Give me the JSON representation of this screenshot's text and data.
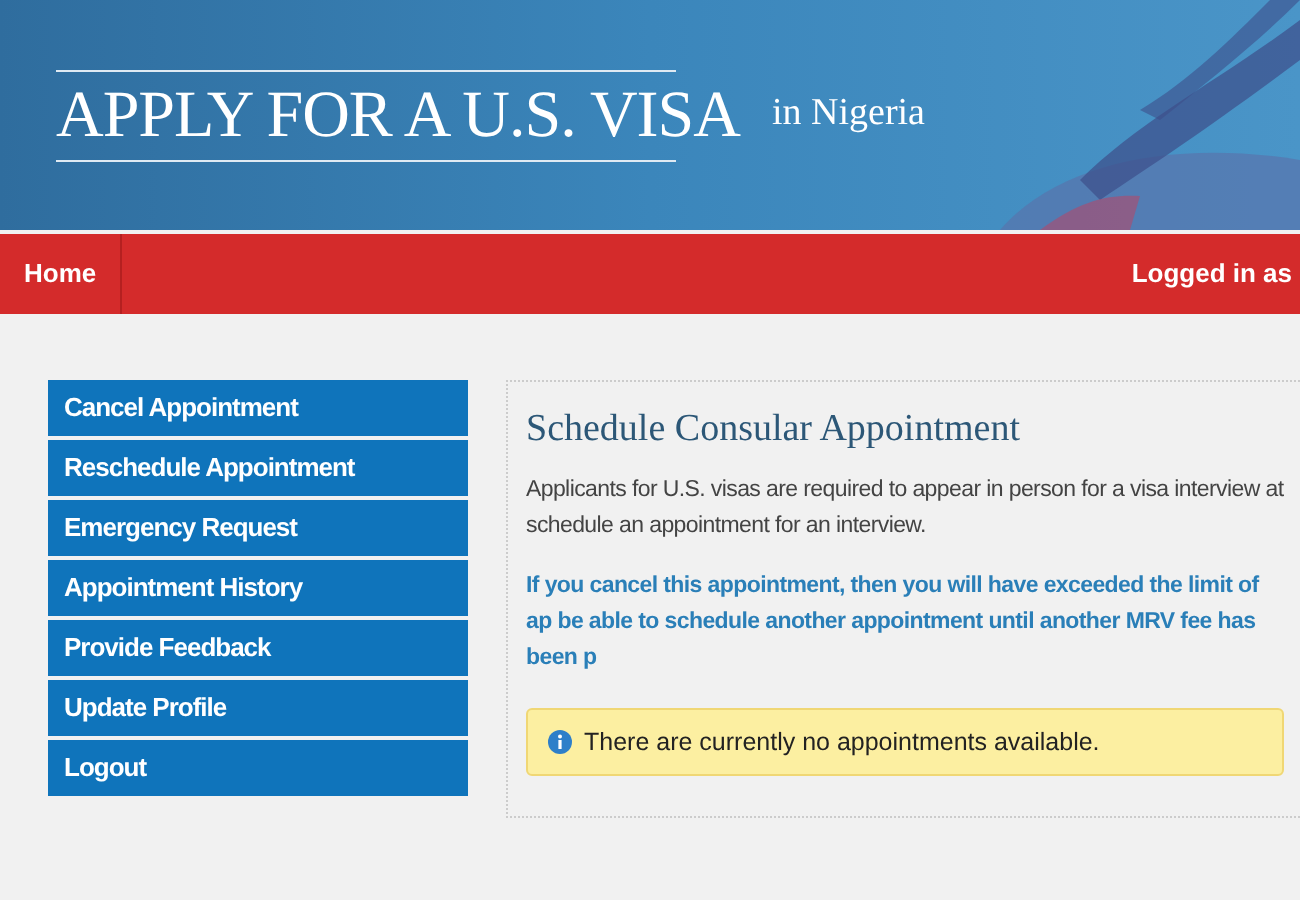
{
  "header": {
    "title": "APPLY FOR A U.S. VISA",
    "subtitle": "in Nigeria"
  },
  "navbar": {
    "items": [
      {
        "label": "Home"
      }
    ],
    "user_text": "Logged in as"
  },
  "sidebar": {
    "items": [
      {
        "label": "Cancel Appointment"
      },
      {
        "label": "Reschedule Appointment"
      },
      {
        "label": "Emergency Request"
      },
      {
        "label": "Appointment History"
      },
      {
        "label": "Provide Feedback"
      },
      {
        "label": "Update Profile"
      },
      {
        "label": "Logout"
      }
    ]
  },
  "content": {
    "heading": "Schedule Consular Appointment",
    "paragraphs": [
      {
        "kind": "plain",
        "text": "Applicants for U.S. visas are required to appear in person for a visa interview at schedule an appointment for an interview."
      },
      {
        "kind": "notice",
        "text": "If you cancel this appointment, then you will have exceeded the limit of ap be able to schedule another appointment until another MRV fee has been p"
      }
    ],
    "alert": {
      "kind": "info",
      "text": "There are currently no appointments available."
    }
  }
}
